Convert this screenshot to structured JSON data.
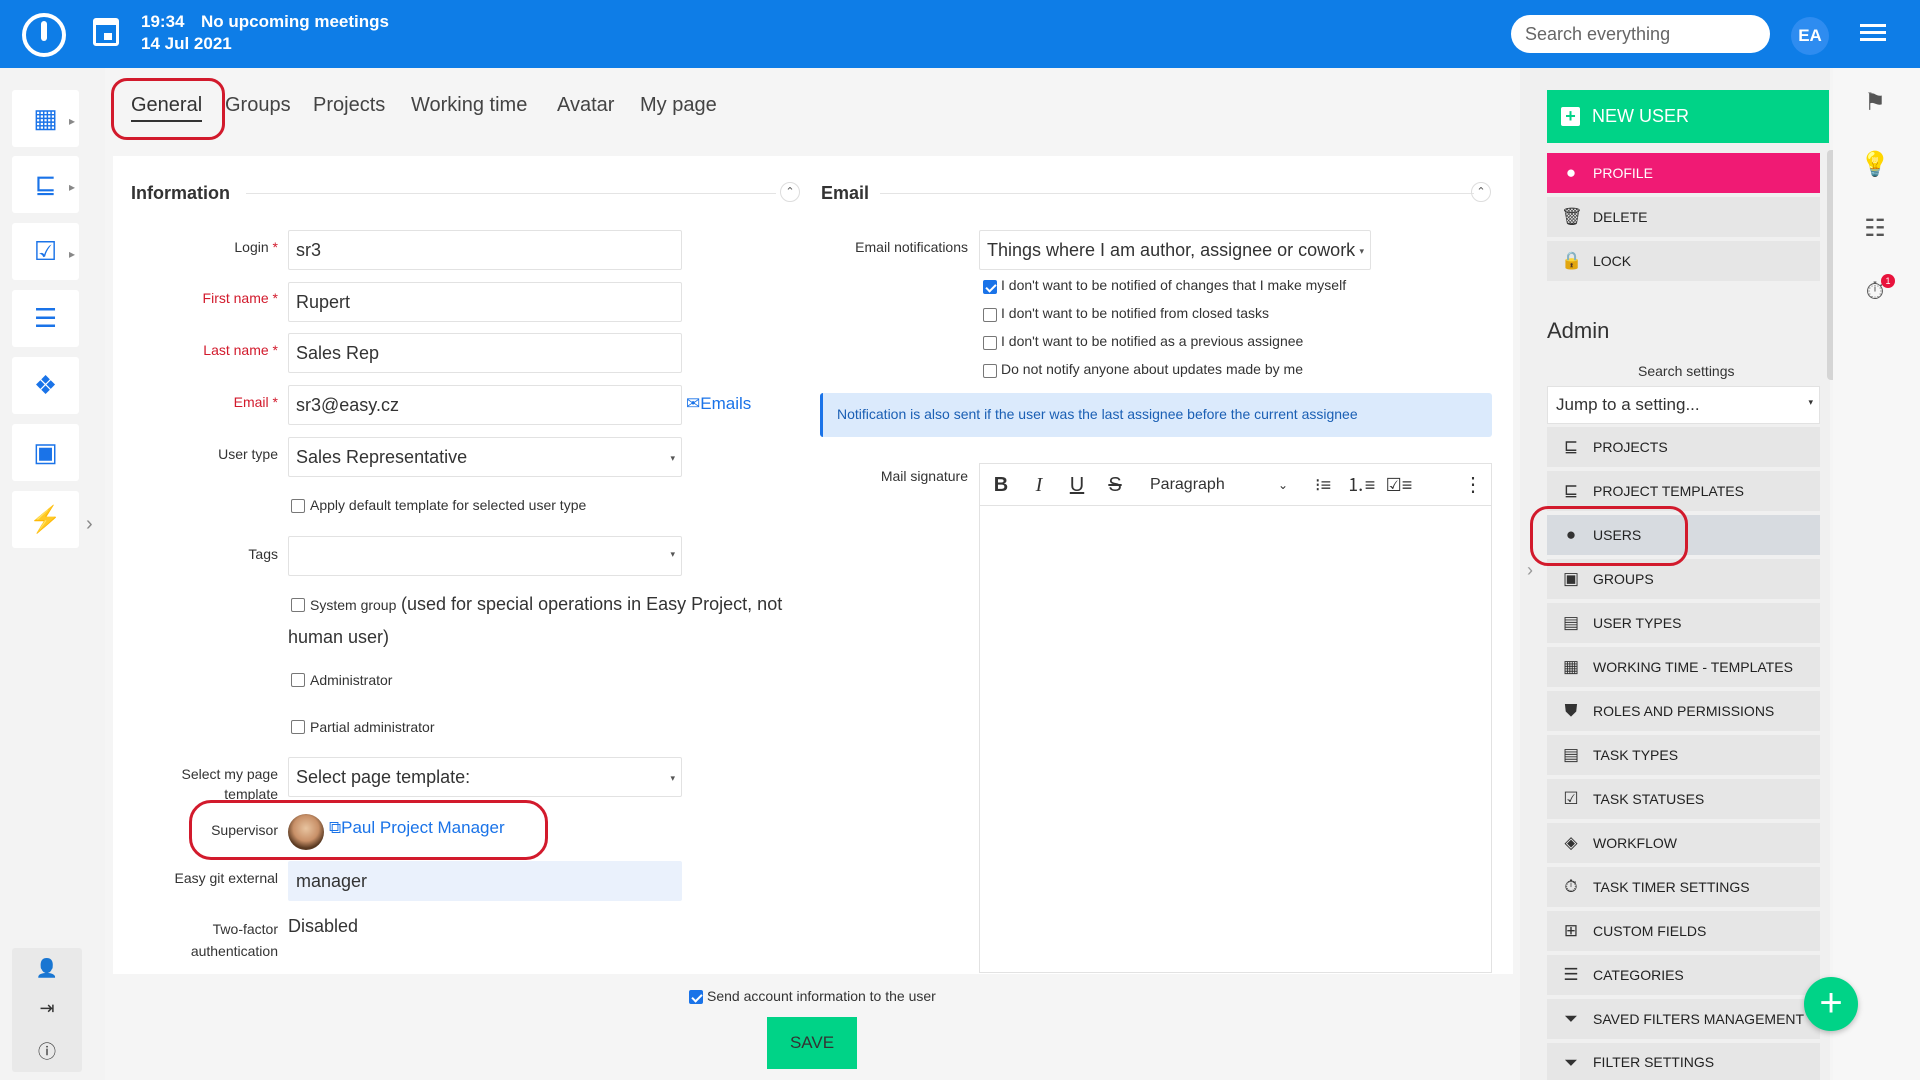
{
  "topbar": {
    "time": "19:34",
    "meetings": "No upcoming meetings",
    "date": "14 Jul 2021",
    "search_placeholder": "Search everything",
    "avatar_initials": "EA"
  },
  "tabs": [
    "General",
    "Groups",
    "Projects",
    "Working time",
    "Avatar",
    "My page"
  ],
  "information": {
    "title": "Information",
    "login_label": "Login",
    "login": "sr3",
    "first_name_label": "First name",
    "first_name": "Rupert",
    "last_name_label": "Last name",
    "last_name": "Sales Rep",
    "email_label": "Email",
    "email": "sr3@easy.cz",
    "emails_link": "Emails",
    "user_type_label": "User type",
    "user_type": "Sales Representative",
    "apply_default": "Apply default template for selected user type",
    "tags_label": "Tags",
    "system_group": "System group",
    "system_group_note_1": "(used for special operations in Easy Project, not",
    "system_group_note_2": "human user)",
    "administrator": "Administrator",
    "partial_admin": "Partial administrator",
    "my_page_label_1": "Select my page",
    "my_page_label_2": "template",
    "my_page_value": "Select page template:",
    "supervisor_label": "Supervisor",
    "supervisor": "Paul Project Manager",
    "git_label": "Easy git external",
    "git_value": "manager",
    "twofa_label_1": "Two-factor",
    "twofa_label_2": "authentication",
    "twofa_value": "Disabled"
  },
  "email": {
    "title": "Email",
    "notifications_label": "Email notifications",
    "notifications_value": "Things where I am author, assignee or cowork",
    "checks": [
      {
        "label": "I don't want to be notified of changes that I make myself",
        "checked": true
      },
      {
        "label": "I don't want to be notified from closed tasks",
        "checked": false
      },
      {
        "label": "I don't want to be notified as a previous assignee",
        "checked": false
      },
      {
        "label": "Do not notify anyone about updates made by me",
        "checked": false
      }
    ],
    "notice": "Notification is also sent if the user was the last assignee before the current assignee",
    "signature_label": "Mail signature",
    "paragraph": "Paragraph"
  },
  "footer": {
    "send_info": "Send account information to the user",
    "save": "SAVE"
  },
  "sidebar": {
    "new_user": "NEW USER",
    "actions": [
      "PROFILE",
      "DELETE",
      "LOCK"
    ],
    "admin_title": "Admin",
    "search_settings": "Search settings",
    "jump": "Jump to a setting...",
    "items": [
      "PROJECTS",
      "PROJECT TEMPLATES",
      "USERS",
      "GROUPS",
      "USER TYPES",
      "WORKING TIME - TEMPLATES",
      "ROLES AND PERMISSIONS",
      "TASK TYPES",
      "TASK STATUSES",
      "WORKFLOW",
      "TASK TIMER SETTINGS",
      "CUSTOM FIELDS",
      "CATEGORIES",
      "SAVED FILTERS MANAGEMENT",
      "FILTER SETTINGS"
    ]
  },
  "colors": {
    "topbar": "#0e7de7",
    "accent_green": "#00d387",
    "accent_pink": "#f01a74",
    "highlight_red": "#d21a2c"
  },
  "right_badge": "1"
}
